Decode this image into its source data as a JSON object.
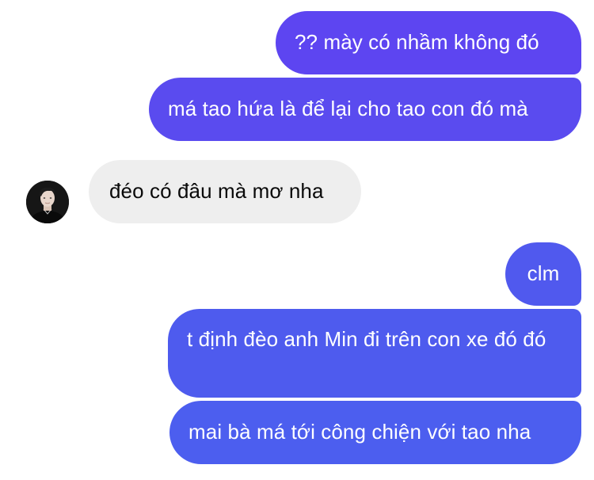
{
  "chat": {
    "messages": [
      {
        "sender": "me",
        "text": "?? mày có nhầm không đó"
      },
      {
        "sender": "me",
        "text": "má tao hứa là để lại cho tao con đó mà"
      },
      {
        "sender": "other",
        "text": "đéo có đâu mà mơ nha",
        "avatar": "profile-photo"
      },
      {
        "sender": "me",
        "text": "clm"
      },
      {
        "sender": "me",
        "text": "t định đèo anh Min đi trên con xe đó đó"
      },
      {
        "sender": "me",
        "text": "mai bà má tới công chiện với tao nha"
      }
    ]
  },
  "colors": {
    "outgoing_top": "#5d45f1",
    "outgoing_bottom": "#4c5eef",
    "incoming_bg": "#eeeeee",
    "incoming_text": "#0a0a0a",
    "outgoing_text": "#ffffff",
    "background": "#ffffff"
  }
}
